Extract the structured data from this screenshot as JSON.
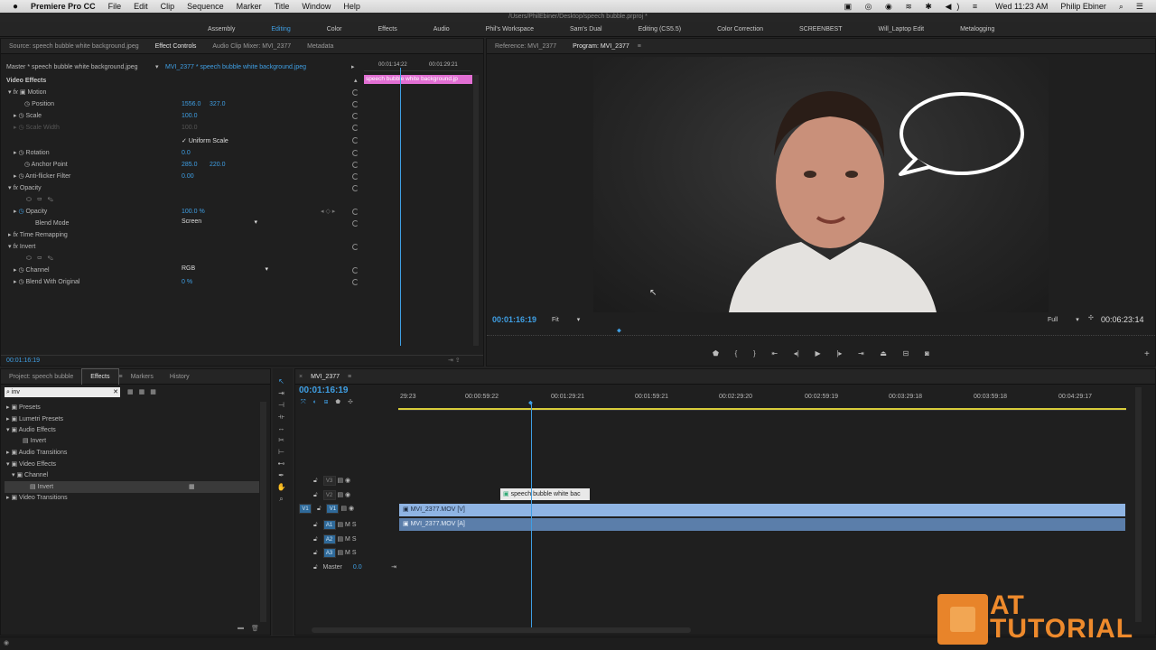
{
  "menubar": {
    "apple": "",
    "app": "Premiere Pro CC",
    "items": [
      "File",
      "Edit",
      "Clip",
      "Sequence",
      "Marker",
      "Title",
      "Window",
      "Help"
    ],
    "clock": "Wed 11:23 AM",
    "user": "Philip Ebiner"
  },
  "title_path": "/Users/PhilEbiner/Desktop/speech bubble.prproj *",
  "workspaces": [
    "Assembly",
    "Editing",
    "Color",
    "Effects",
    "Audio",
    "Phil's Workspace",
    "Sam's Dual",
    "Editing (CS5.5)",
    "Color Correction",
    "SCREENBEST",
    "Will_Laptop Edit",
    "Metalogging"
  ],
  "source_tabs": [
    "Source: speech bubble white background.jpeg",
    "Effect Controls",
    "Audio Clip Mixer: MVI_2377",
    "Metadata"
  ],
  "effect_controls": {
    "master_label": "Master * speech bubble white background.jpeg",
    "clip_label": "MVI_2377 * speech bubble white background.jpeg",
    "ruler_t1": "00:01:14:22",
    "ruler_t2": "00:01:29:21",
    "clip_bar": "speech bubble white background.jp",
    "video_effects": "Video Effects",
    "params": [
      {
        "name": "Motion",
        "value": "",
        "value2": "",
        "fx": true
      },
      {
        "name": "Position",
        "value": "1556.0",
        "value2": "327.0"
      },
      {
        "name": "Scale",
        "value": "100.0",
        "value2": ""
      },
      {
        "name": "Scale Width",
        "value": "100.0",
        "value2": ""
      },
      {
        "name": "Uniform Scale",
        "value": "",
        "value2": ""
      },
      {
        "name": "Rotation",
        "value": "0.0",
        "value2": ""
      },
      {
        "name": "Anchor Point",
        "value": "285.0",
        "value2": "220.0"
      },
      {
        "name": "Anti-flicker Filter",
        "value": "0.00",
        "value2": ""
      },
      {
        "name": "Opacity",
        "value": "",
        "value2": "",
        "fx": true
      },
      {
        "name": "Opacity",
        "value": "100.0 %",
        "value2": ""
      },
      {
        "name": "Blend Mode",
        "value": "Screen",
        "value2": ""
      },
      {
        "name": "Time Remapping",
        "value": "",
        "value2": "",
        "fx": true
      },
      {
        "name": "Invert",
        "value": "",
        "value2": "",
        "fx": true
      },
      {
        "name": "Channel",
        "value": "RGB",
        "value2": ""
      },
      {
        "name": "Blend With Original",
        "value": "0 %",
        "value2": ""
      }
    ],
    "timecode": "00:01:16:19"
  },
  "program_tabs": [
    "Reference: MVI_2377",
    "Program: MVI_2377"
  ],
  "program": {
    "timecode": "00:01:16:19",
    "fit": "Fit",
    "quality": "Full",
    "duration": "00:06:23:14"
  },
  "project_tabs": [
    "Project: speech bubble",
    "Effects",
    "Markers",
    "History"
  ],
  "effects_panel": {
    "search_value": "inv",
    "tree": [
      {
        "label": "Presets",
        "level": 0
      },
      {
        "label": "Lumetri Presets",
        "level": 0
      },
      {
        "label": "Audio Effects",
        "level": 0
      },
      {
        "label": "Invert",
        "level": 1
      },
      {
        "label": "Audio Transitions",
        "level": 0
      },
      {
        "label": "Video Effects",
        "level": 0
      },
      {
        "label": "Channel",
        "level": 1
      },
      {
        "label": "Invert",
        "level": 2
      },
      {
        "label": "Video Transitions",
        "level": 0
      }
    ]
  },
  "timeline": {
    "tab": "MVI_2377",
    "timecode": "00:01:16:19",
    "ruler": [
      "29:23",
      "00:00:59:22",
      "00:01:29:21",
      "00:01:59:21",
      "00:02:29:20",
      "00:02:59:19",
      "00:03:29:18",
      "00:03:59:18",
      "00:04:29:17"
    ],
    "tracks": [
      {
        "label": "V3",
        "type": "video"
      },
      {
        "label": "V2",
        "type": "video"
      },
      {
        "label": "V1",
        "type": "video"
      },
      {
        "label": "A1",
        "type": "audio"
      },
      {
        "label": "A2",
        "type": "audio"
      },
      {
        "label": "A3",
        "type": "audio"
      }
    ],
    "source_patch": "V1",
    "master_label": "Master",
    "master_value": "0.0",
    "clips": {
      "v2": "speech bubble white bac",
      "v1": "MVI_2377.MOV [V]",
      "a1": "MVI_2377.MOV [A]"
    }
  },
  "watermark": {
    "line1": "AT",
    "line2": "TUTORIAL"
  },
  "colors": {
    "accent": "#3f9fe4",
    "clip_pink": "#e16fd3",
    "clip_video": "#8fb4e3",
    "clip_audio": "#5b7eaa",
    "playhead": "#3f9fe4"
  }
}
